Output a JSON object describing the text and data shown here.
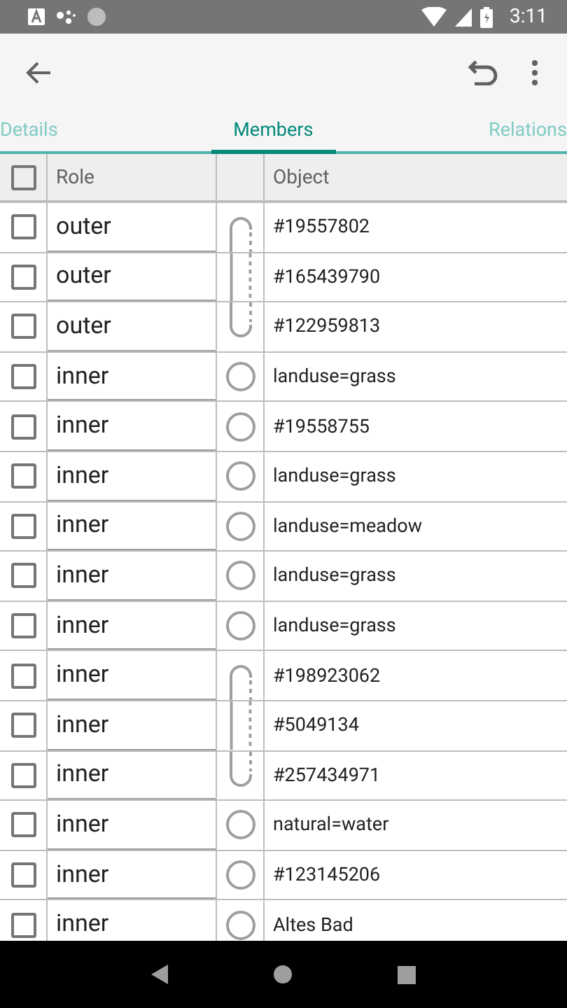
{
  "status_bar": {
    "time": "3:11"
  },
  "tabs": [
    {
      "label": "Details",
      "selected": false
    },
    {
      "label": "Members",
      "selected": true
    },
    {
      "label": "Relations",
      "selected": false
    }
  ],
  "table": {
    "header": {
      "checked": false,
      "role": "Role",
      "object": "Object"
    },
    "rows": [
      {
        "checked": false,
        "role": "outer",
        "kind": "start",
        "object": "#19557802"
      },
      {
        "checked": false,
        "role": "outer",
        "kind": "middle",
        "object": "#165439790"
      },
      {
        "checked": false,
        "role": "outer",
        "kind": "end",
        "object": "#122959813"
      },
      {
        "checked": false,
        "role": "inner",
        "kind": "single",
        "object": "landuse=grass"
      },
      {
        "checked": false,
        "role": "inner",
        "kind": "single",
        "object": "#19558755"
      },
      {
        "checked": false,
        "role": "inner",
        "kind": "single",
        "object": "landuse=grass"
      },
      {
        "checked": false,
        "role": "inner",
        "kind": "single",
        "object": "landuse=meadow"
      },
      {
        "checked": false,
        "role": "inner",
        "kind": "single",
        "object": "landuse=grass"
      },
      {
        "checked": false,
        "role": "inner",
        "kind": "single",
        "object": "landuse=grass"
      },
      {
        "checked": false,
        "role": "inner",
        "kind": "start",
        "object": "#198923062"
      },
      {
        "checked": false,
        "role": "inner",
        "kind": "middle",
        "object": "#5049134"
      },
      {
        "checked": false,
        "role": "inner",
        "kind": "end",
        "object": "#257434971"
      },
      {
        "checked": false,
        "role": "inner",
        "kind": "single",
        "object": "natural=water"
      },
      {
        "checked": false,
        "role": "inner",
        "kind": "single",
        "object": "#123145206"
      },
      {
        "checked": false,
        "role": "inner",
        "kind": "single",
        "object": "Altes Bad"
      }
    ]
  }
}
